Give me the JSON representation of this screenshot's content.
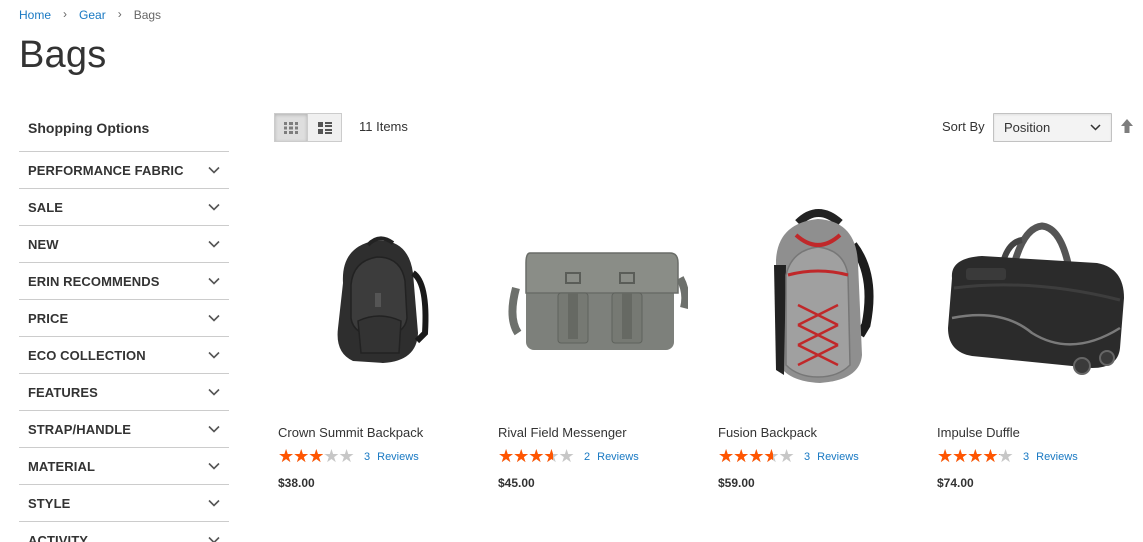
{
  "breadcrumb": {
    "home": "Home",
    "gear": "Gear",
    "current": "Bags",
    "separator": "›"
  },
  "page_title": "Bags",
  "sidebar": {
    "title": "Shopping Options",
    "filters": [
      "PERFORMANCE FABRIC",
      "SALE",
      "NEW",
      "ERIN RECOMMENDS",
      "PRICE",
      "ECO COLLECTION",
      "FEATURES",
      "STRAP/HANDLE",
      "MATERIAL",
      "STYLE",
      "ACTIVITY"
    ]
  },
  "toolbar": {
    "items_count": "11 Items",
    "sort_label": "Sort By",
    "sort_value": "Position",
    "view_modes": [
      "grid",
      "list"
    ],
    "active_mode": "grid"
  },
  "products": [
    {
      "name": "Crown Summit Backpack",
      "rating": 0.6,
      "review_count": "3",
      "review_label": "Reviews",
      "price": "$38.00",
      "image": "backpack-black-icon"
    },
    {
      "name": "Rival Field Messenger",
      "rating": 0.7,
      "review_count": "2",
      "review_label": "Reviews",
      "price": "$45.00",
      "image": "messenger-bag-icon"
    },
    {
      "name": "Fusion Backpack",
      "rating": 0.7,
      "review_count": "3",
      "review_label": "Reviews",
      "price": "$59.00",
      "image": "backpack-gray-red-icon"
    },
    {
      "name": "Impulse Duffle",
      "rating": 0.8,
      "review_count": "3",
      "review_label": "Reviews",
      "price": "$74.00",
      "image": "duffle-bag-icon"
    }
  ],
  "colors": {
    "link": "#1979c3",
    "star": "#ff5501",
    "star_empty": "#c7c7c7",
    "border": "#cccccc"
  }
}
